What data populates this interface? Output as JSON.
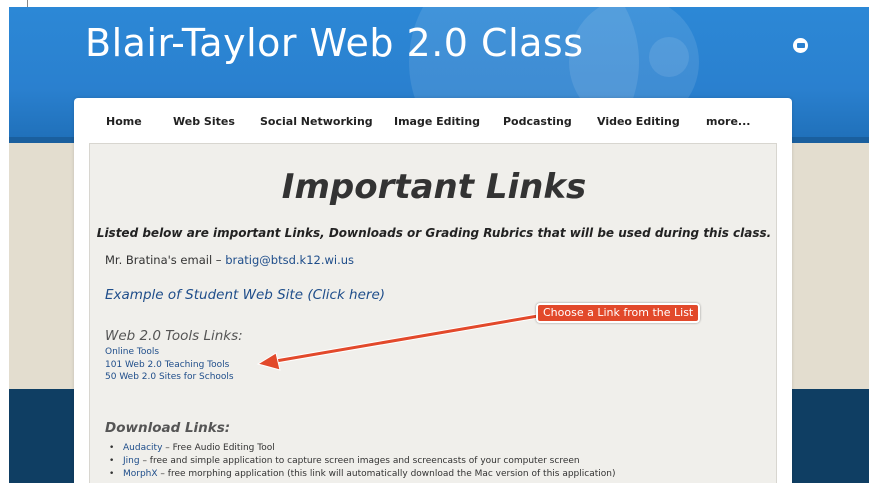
{
  "site": {
    "title": "Blair-Taylor Web 2.0 Class",
    "mail_icon": "mail-icon"
  },
  "nav": {
    "items": [
      "Home",
      "Web Sites",
      "Social Networking",
      "Image Editing",
      "Podcasting",
      "Video Editing",
      "more..."
    ]
  },
  "main": {
    "heading": "Important Links",
    "subheading": "Listed below are important Links, Downloads or Grading Rubrics that will be used during this class.",
    "email_prefix": "Mr. Bratina's email – ",
    "email": "bratig@btsd.k12.wi.us",
    "example_link": "Example of Student Web Site (Click here)",
    "tools": {
      "title": "Web 2.0 Tools Links:",
      "links": [
        "Online Tools",
        "101 Web 2.0 Teaching Tools",
        "50 Web 2.0 Sites for Schools"
      ]
    },
    "callout": "Choose a Link from the List",
    "downloads": {
      "title": "Download Links:",
      "items": [
        {
          "name": "Audacity",
          "desc": " – Free Audio Editing Tool"
        },
        {
          "name": "Jing",
          "desc": " – free and simple application to capture screen images and screencasts of your computer screen"
        },
        {
          "name": "MorphX",
          "desc": " – free morphing application (this link will automatically download the Mac version of this application)"
        }
      ]
    }
  },
  "colors": {
    "header_blue": "#2a80cf",
    "callout_red": "#e2492b",
    "link_blue": "#1e4d8a",
    "footer_navy": "#0f3e63"
  }
}
